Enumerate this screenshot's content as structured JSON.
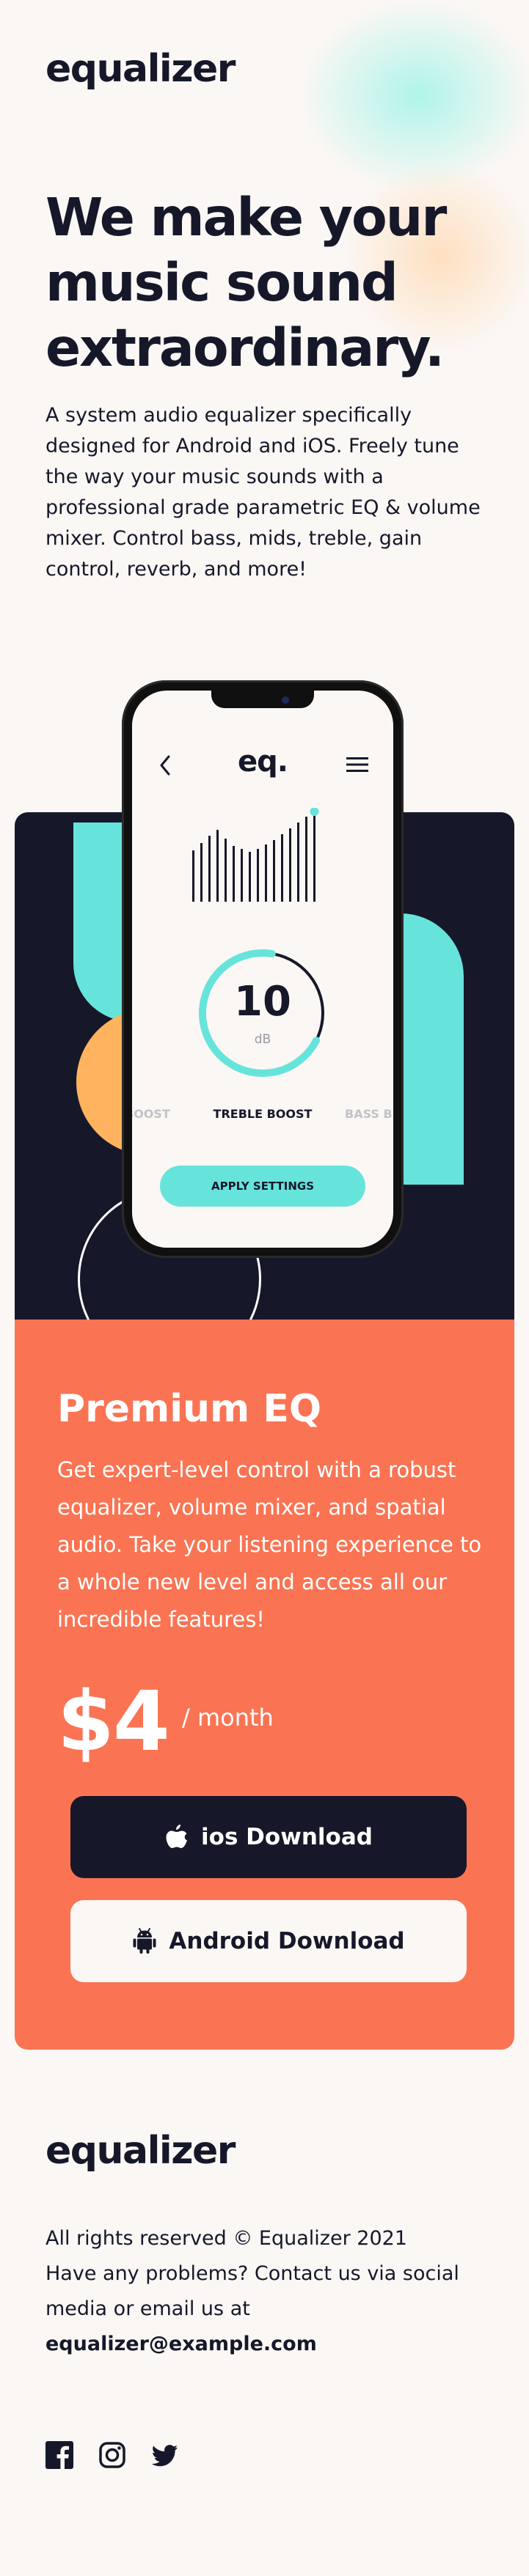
{
  "header": {
    "logo": "equalizer"
  },
  "hero": {
    "title": "We make your music sound extraordinary.",
    "description": "A system audio equalizer specifically designed for Android and iOS. Freely tune the way your music sounds with a professional grade parametric EQ & volume mixer. Control bass, mids, treble, gain control, reverb, and more!"
  },
  "phone": {
    "logo": "eq.",
    "level_value": "10",
    "level_unit": "dB",
    "dial_fraction": 0.7,
    "presets": [
      "BOOST",
      "TREBLE BOOST",
      "BASS B"
    ],
    "apply_label": "APPLY SETTINGS"
  },
  "premium": {
    "title": "Premium EQ",
    "description": "Get expert-level control with a robust equalizer, volume mixer, and spatial audio. Take your listening experience to a whole new level and access all our incredible features!",
    "price": "$4",
    "period": "/ month",
    "ios_label": "ios Download",
    "android_label": "Android Download"
  },
  "footer": {
    "logo": "equalizer",
    "rights": "All rights reserved © Equalizer 2021",
    "contact": "Have any problems? Contact us via social media or email us at",
    "email": "equalizer@example.com",
    "social_icons": [
      "facebook-icon",
      "instagram-icon",
      "twitter-icon"
    ]
  },
  "colors": {
    "background": "#fbf7f4",
    "dark": "#16182a",
    "mint": "#66e4db",
    "orange": "#ffb35f",
    "coral": "#fa7453"
  }
}
